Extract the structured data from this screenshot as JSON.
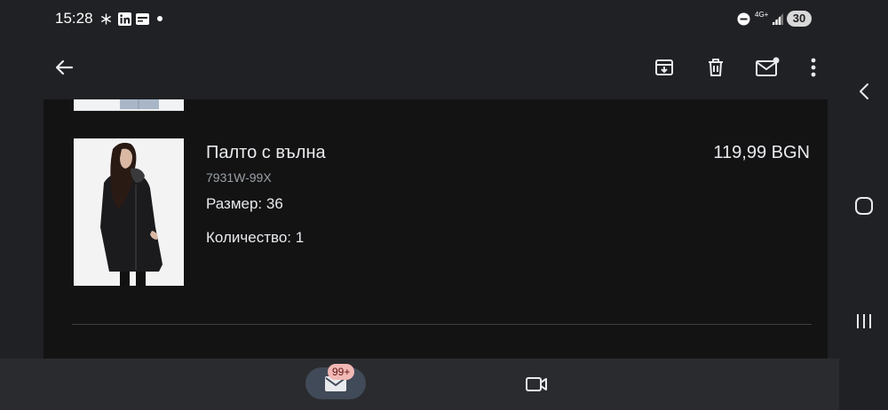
{
  "status_bar": {
    "time": "15:28",
    "network": "4G+",
    "battery": "30",
    "icons": [
      "snowflake-icon",
      "linkedin-icon",
      "wallet-icon",
      "dot-icon",
      "do-not-disturb-icon",
      "signal-icon"
    ]
  },
  "toolbar": {
    "icons": [
      "back-arrow-icon",
      "archive-icon",
      "delete-icon",
      "mark-unread-icon",
      "more-vert-icon"
    ]
  },
  "product": {
    "title": "Палто с вълна",
    "sku": "7931W-99X",
    "size": "Размер: 36",
    "quantity": "Количество: 1",
    "price": "119,99 BGN"
  },
  "bottom_nav": {
    "mail_badge": "99+",
    "icons": [
      "mail-icon",
      "video-icon"
    ]
  },
  "system_nav": {
    "icons": [
      "back-chevron-icon",
      "home-icon",
      "recents-icon"
    ]
  }
}
